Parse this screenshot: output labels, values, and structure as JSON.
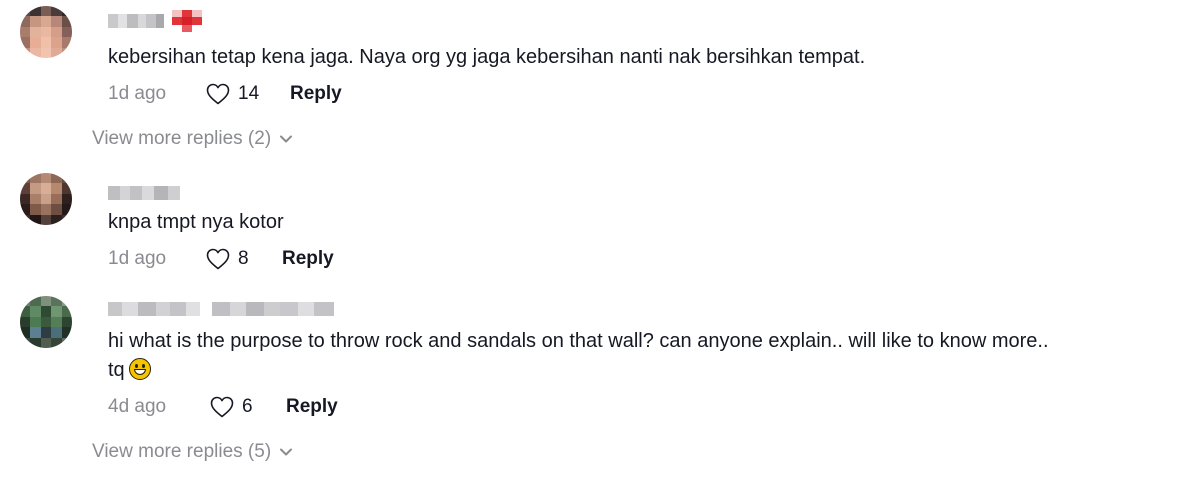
{
  "comments": [
    {
      "avatar": "blurred-avatar",
      "username_hidden": "pixelated-username",
      "text": "kebersihan tetap kena jaga. Naya org yg jaga kebersihan nanti nak bersihkan tempat.",
      "time": "1d ago",
      "likes": "14",
      "reply_label": "Reply"
    },
    {
      "avatar": "blurred-avatar",
      "username_hidden": "pixelated-username",
      "text": "knpa tmpt nya kotor",
      "time": "1d ago",
      "likes": "8",
      "reply_label": "Reply"
    },
    {
      "avatar": "blurred-avatar",
      "username_hidden": "pixelated-username",
      "text_line1": "hi what is the purpose to throw rock and sandals on that wall? can anyone explain.. will like to know more..",
      "text_line2": "tq",
      "emoji": "grinning-face-emoji",
      "time": "4d ago",
      "likes": "6",
      "reply_label": "Reply"
    }
  ],
  "view_more": [
    {
      "label": "View more replies (2)"
    },
    {
      "label": "View more replies (5)"
    }
  ],
  "icons": {
    "like": "heart-outline-icon",
    "expand": "chevron-down-icon"
  },
  "colors": {
    "text": "#161823",
    "muted": "#8a8b91"
  }
}
